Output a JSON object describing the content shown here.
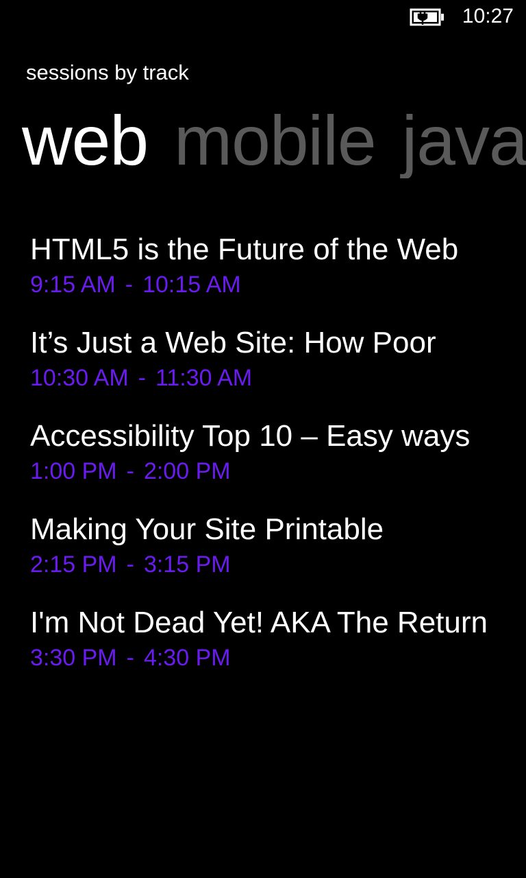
{
  "status_bar": {
    "time": "10:27",
    "battery_icon": "battery-charging-icon"
  },
  "app": {
    "title": "sessions by track"
  },
  "pivot": {
    "items": [
      {
        "label": "web",
        "active": true
      },
      {
        "label": "mobile",
        "active": false
      },
      {
        "label": "java",
        "active": false
      }
    ]
  },
  "sessions": [
    {
      "title": "HTML5 is the Future of the Web",
      "start": "9:15 AM",
      "separator": "-",
      "end": "10:15 AM"
    },
    {
      "title": "It’s Just a Web Site: How Poor",
      "start": "10:30 AM",
      "separator": "-",
      "end": "11:30 AM"
    },
    {
      "title": "Accessibility Top 10 – Easy ways",
      "start": "1:00 PM",
      "separator": "-",
      "end": "2:00 PM"
    },
    {
      "title": "Making Your Site Printable",
      "start": "2:15 PM",
      "separator": "-",
      "end": "3:15 PM"
    },
    {
      "title": "I'm Not Dead Yet! AKA The Return",
      "start": "3:30 PM",
      "separator": "-",
      "end": "4:30 PM"
    }
  ],
  "colors": {
    "background": "#000000",
    "accent": "#6a1bf0",
    "inactive_header": "#5a5a5a",
    "text": "#ffffff"
  }
}
